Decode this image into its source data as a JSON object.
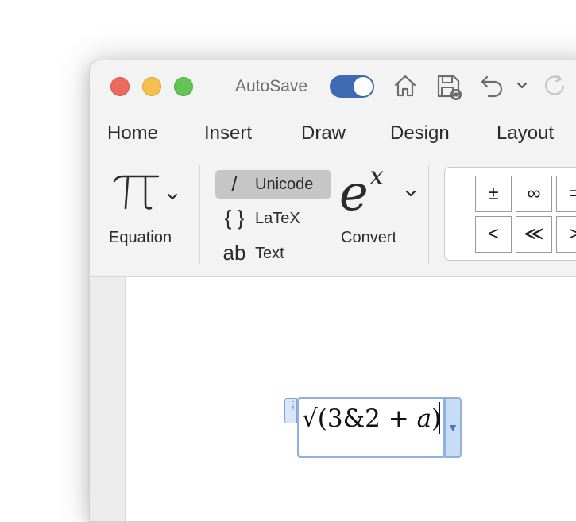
{
  "titlebar": {
    "autosave_label": "AutoSave",
    "autosave_on": true,
    "icons": [
      "home-icon",
      "save-icon",
      "undo-icon",
      "chevron-down-icon",
      "redo-icon"
    ]
  },
  "tabs": [
    "Home",
    "Insert",
    "Draw",
    "Design",
    "Layout"
  ],
  "ribbon": {
    "equation_label": "Equation",
    "equation_glyph": "π",
    "formats": [
      {
        "glyph": "/",
        "label": "Unicode",
        "selected": true
      },
      {
        "glyph": "{ }",
        "label": "LaTeX",
        "selected": false
      },
      {
        "glyph": "ab",
        "label": "Text",
        "selected": false
      }
    ],
    "convert_label": "Convert",
    "convert_glyph_base": "e",
    "convert_glyph_sup": "x",
    "symbols_row1": [
      "±",
      "∞",
      "="
    ],
    "symbols_row2": [
      "<",
      "≪",
      ">"
    ]
  },
  "equation": {
    "prefix": "√(3&2 + ",
    "variable": "a",
    "suffix": ")"
  },
  "colors": {
    "toggle_on": "#3d6bb3",
    "close": "#ed6a5e",
    "minimize": "#f5bf4f",
    "zoom": "#62c554",
    "equation_border": "#8fb0e0"
  }
}
